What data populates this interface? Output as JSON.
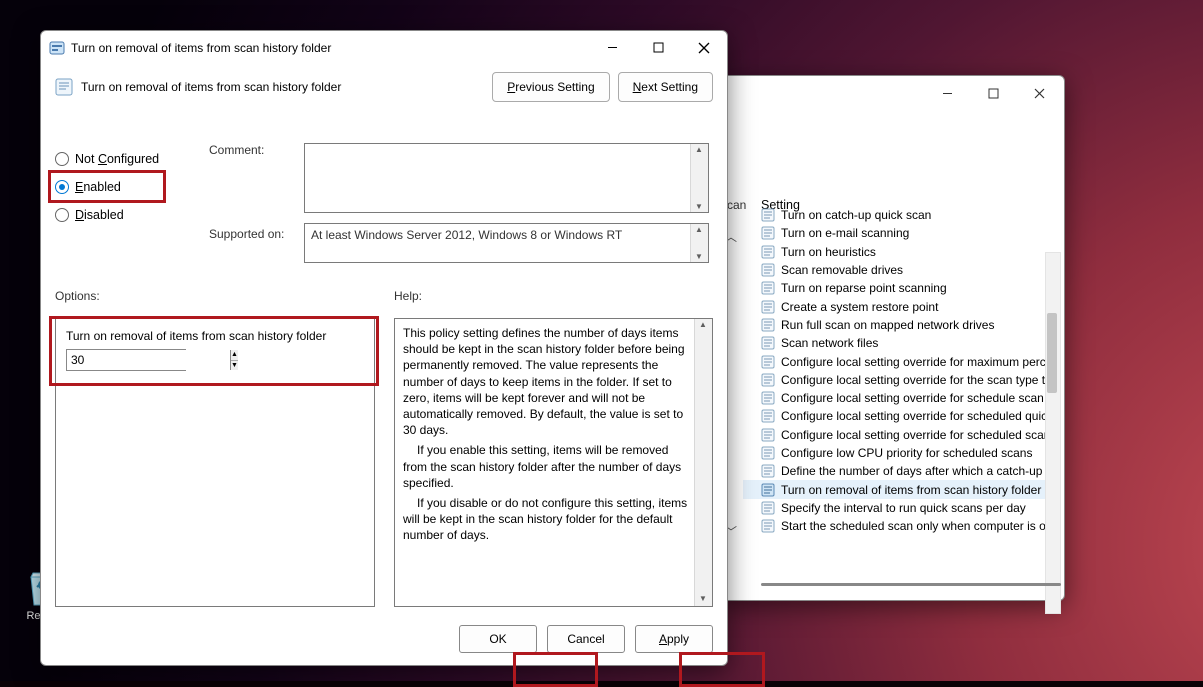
{
  "desktop": {
    "recycle_bin_label": "Recycl"
  },
  "gpedit_window": {
    "column_header": "Setting",
    "items": [
      "Turn on catch-up quick scan",
      "Turn on e-mail scanning",
      "Turn on heuristics",
      "Scan removable drives",
      "Turn on reparse point scanning",
      "Create a system restore point",
      "Run full scan on mapped network drives",
      "Scan network files",
      "Configure local setting override for maximum perce",
      "Configure local setting override for the scan type to",
      "Configure local setting override for schedule scan da",
      "Configure local setting override for scheduled quick",
      "Configure local setting override for scheduled scan t",
      "Configure low CPU priority for scheduled scans",
      "Define the number of days after which a catch-up sc",
      "Turn on removal of items from scan history folder",
      "Specify the interval to run quick scans per day",
      "Start the scheduled scan only when computer is on b"
    ],
    "selected_index": 15,
    "scan_label": "can"
  },
  "policy_dialog": {
    "window_title": "Turn on removal of items from scan history folder",
    "subtitle": "Turn on removal of items from scan history folder",
    "nav": {
      "prev": {
        "underline_char": "P",
        "rest": "revious Setting"
      },
      "next": {
        "underline_char": "N",
        "rest": "ext Setting"
      }
    },
    "radios": {
      "not_configured": {
        "label_rest": "Not ",
        "underline": "C",
        "label_rest2": "onfigured",
        "checked": false
      },
      "enabled": {
        "underline": "E",
        "rest": "nabled",
        "checked": true
      },
      "disabled": {
        "underline": "D",
        "rest": "isabled",
        "checked": false
      }
    },
    "comment_label": "Comment:",
    "comment_value": "",
    "supported_label": "Supported on:",
    "supported_value": "At least Windows Server 2012, Windows 8 or Windows RT",
    "options_label": "Options:",
    "help_label": "Help:",
    "option_text": "Turn on removal of items from scan history folder",
    "option_value": "30",
    "help_paragraphs": [
      "This policy setting defines the number of days items should be kept in the scan history folder before being permanently removed. The value represents the number of days to keep items in the folder. If set to zero, items will be kept forever and will not be automatically removed. By default, the value is set to 30 days.",
      "If you enable this setting, items will be removed from the scan history folder after the number of days specified.",
      "If you disable or do not configure this setting, items will be kept in the scan history folder for the default number of days."
    ],
    "buttons": {
      "ok": "OK",
      "cancel": "Cancel",
      "apply_underline": "A",
      "apply_rest": "pply"
    }
  }
}
